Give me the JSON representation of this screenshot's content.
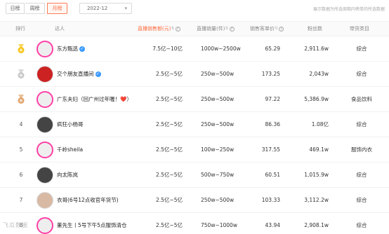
{
  "topbar": {
    "tabs": [
      "日榜",
      "周榜",
      "月榜"
    ],
    "active_tab": "月榜",
    "month": "2022-12",
    "note": "展示数据为所选周期内榜单的所选数据"
  },
  "table": {
    "headers": {
      "rank": "排行",
      "name": "达人",
      "sales": "直播销售额(元)",
      "qty": "直播销量(件)",
      "price": "销售客单价",
      "fans": "粉丝数",
      "category": "带货类目"
    },
    "rows": [
      {
        "rank": "",
        "medal": "gold",
        "name": "东方甄选",
        "verified": true,
        "sales": "7.5亿~10亿",
        "qty": "1000w~2500w",
        "price": "65.29",
        "fans": "2,911.6w",
        "category": "综合"
      },
      {
        "rank": "",
        "medal": "silver",
        "name": "交个朋友直播间",
        "verified": true,
        "sales": "2.5亿~5亿",
        "qty": "250w~500w",
        "price": "173.25",
        "fans": "2,043w",
        "category": "综合"
      },
      {
        "rank": "",
        "medal": "bronze",
        "name": "广东夫妇（回广州过年喔！❤️）",
        "verified": false,
        "sales": "2.5亿~5亿",
        "qty": "250w~500w",
        "price": "97.22",
        "fans": "5,386.9w",
        "category": "食品饮料"
      },
      {
        "rank": "4",
        "medal": "",
        "name": "疯狂小杨哥",
        "verified": false,
        "sales": "2.5亿~5亿",
        "qty": "250w~500w",
        "price": "86.36",
        "fans": "1.08亿",
        "category": "综合"
      },
      {
        "rank": "5",
        "medal": "",
        "name": "千岭sheila",
        "verified": false,
        "sales": "2.5亿~5亿",
        "qty": "100w~250w",
        "price": "317.55",
        "fans": "469.1w",
        "category": "服饰内衣"
      },
      {
        "rank": "6",
        "medal": "",
        "name": "向太陈岚",
        "verified": false,
        "sales": "2.5亿~5亿",
        "qty": "500w~750w",
        "price": "60.51",
        "fans": "1,015.9w",
        "category": "综合"
      },
      {
        "rank": "7",
        "medal": "",
        "name": "衣哥(6号12点收官年货节)",
        "verified": false,
        "sales": "2.5亿~5亿",
        "qty": "250w~500w",
        "price": "103.33",
        "fans": "3,112.2w",
        "category": "综合"
      },
      {
        "rank": "8",
        "medal": "",
        "name": "董先生丨5号下午5点服饰清仓",
        "verified": false,
        "sales": "2.5亿~5亿",
        "qty": "750w~1000w",
        "price": "43.94",
        "fans": "2,908.1w",
        "category": "综合"
      }
    ]
  },
  "watermark": "飞瓜数据",
  "colors": {
    "accent": "#ff6a3d",
    "verify": "#3d9bff",
    "gold": "#f5c518",
    "silver": "#c7c7c7",
    "bronze": "#e0a36a"
  }
}
